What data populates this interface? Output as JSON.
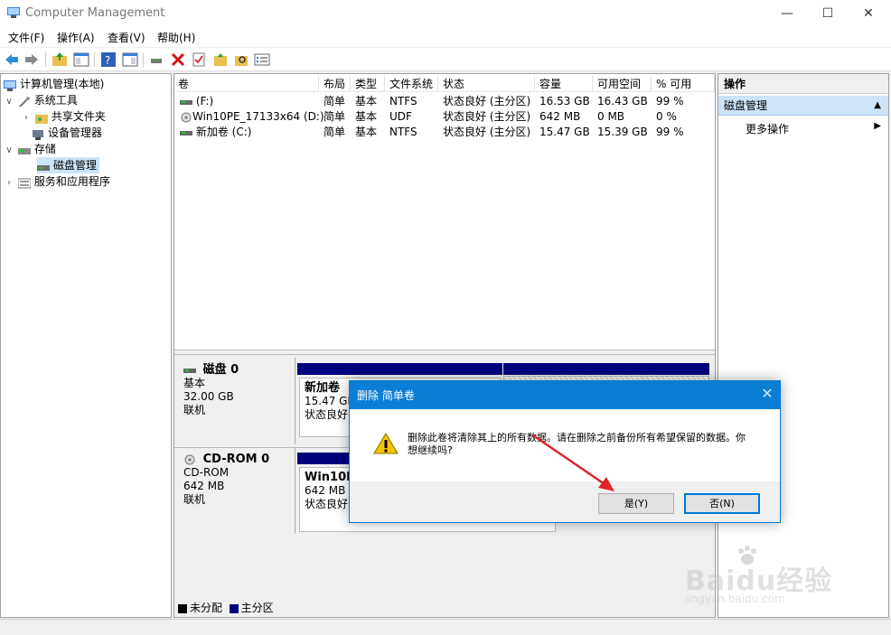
{
  "window": {
    "title": "Computer Management"
  },
  "menu": [
    "文件(F)",
    "操作(A)",
    "查看(V)",
    "帮助(H)"
  ],
  "tree": [
    {
      "label": "计算机管理(本地)",
      "chevron": "",
      "icon": "computer-icon",
      "indent": 0
    },
    {
      "label": "系统工具",
      "chevron": "v",
      "icon": "tools-icon",
      "indent": 1
    },
    {
      "label": "共享文件夹",
      "chevron": ">",
      "icon": "shared-folder-icon",
      "indent": 2
    },
    {
      "label": "设备管理器",
      "chevron": "",
      "icon": "device-manager-icon",
      "indent": 2
    },
    {
      "label": "存储",
      "chevron": "v",
      "icon": "storage-icon",
      "indent": 1
    },
    {
      "label": "磁盘管理",
      "chevron": "",
      "icon": "disk-management-icon",
      "indent": 2,
      "selected": true
    },
    {
      "label": "服务和应用程序",
      "chevron": ">",
      "icon": "services-icon",
      "indent": 1
    }
  ],
  "volumes": {
    "columns": [
      "卷",
      "布局",
      "类型",
      "文件系统",
      "状态",
      "容量",
      "可用空间",
      "% 可用"
    ],
    "rows": [
      [
        "(F:)",
        "简单",
        "基本",
        "NTFS",
        "状态良好 (主分区)",
        "16.53 GB",
        "16.43 GB",
        "99 %"
      ],
      [
        "Win10PE_17133x64 (D:)",
        "简单",
        "基本",
        "UDF",
        "状态良好 (主分区)",
        "642 MB",
        "0 MB",
        "0 %"
      ],
      [
        "新加卷 (C:)",
        "简单",
        "基本",
        "NTFS",
        "状态良好 (主分区)",
        "15.47 GB",
        "15.39 GB",
        "99 %"
      ]
    ]
  },
  "disks": [
    {
      "name": "磁盘 0",
      "type": "基本",
      "size": "32.00 GB",
      "status": "联机",
      "partition": {
        "label": "新加卷",
        "size": "15.47 GB",
        "status": "状态良好"
      }
    },
    {
      "name": "CD-ROM 0",
      "type": "CD-ROM",
      "size": "642 MB",
      "status": "联机",
      "partition": {
        "label": "Win10P",
        "size": "642 MB",
        "status": "状态良好"
      }
    }
  ],
  "legend": [
    {
      "label": "未分配",
      "color": "#000000"
    },
    {
      "label": "主分区",
      "color": "#00007f"
    }
  ],
  "actions": {
    "header": "操作",
    "section": "磁盘管理",
    "more": "更多操作"
  },
  "dialog": {
    "title": "删除 简单卷",
    "message": "删除此卷将清除其上的所有数据。请在删除之前备份所有希望保留的数据。你想继续吗?",
    "yes": "是(Y)",
    "no": "否(N)"
  },
  "watermark": {
    "brand": "Baidu经验",
    "url": "jingyan.baidu.com"
  },
  "colors": {
    "dialog_title": "#0a7ed5",
    "partition_bar": "#00007f",
    "selection": "#cce4f7",
    "arrow": "#e0242b"
  }
}
